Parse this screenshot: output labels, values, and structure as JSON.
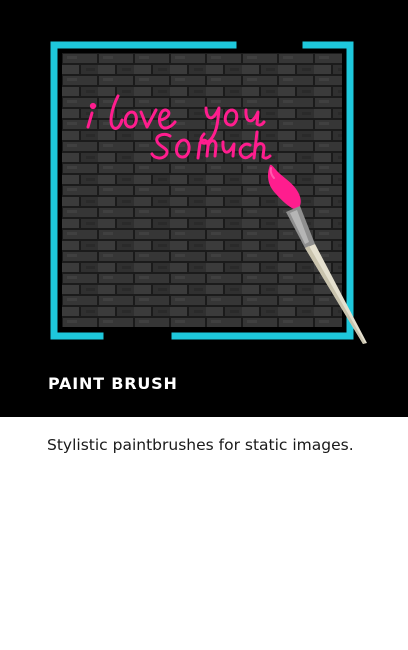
{
  "feature_card": {
    "title": "PAINT BRUSH",
    "description": "Stylistic paintbrushes for static images.",
    "artwork": {
      "subject": "paintbrush-on-brick-wall",
      "handwritten_text_line1": "i love you",
      "handwritten_text_line2": "so much"
    }
  },
  "colors": {
    "hero_background": "#000000",
    "frame_accent": "#1ec8dc",
    "paint_pink": "#ff1d8e",
    "brick_wall": "#3a3a3a",
    "title_text": "#ffffff",
    "description_text": "#1a1a1a"
  }
}
